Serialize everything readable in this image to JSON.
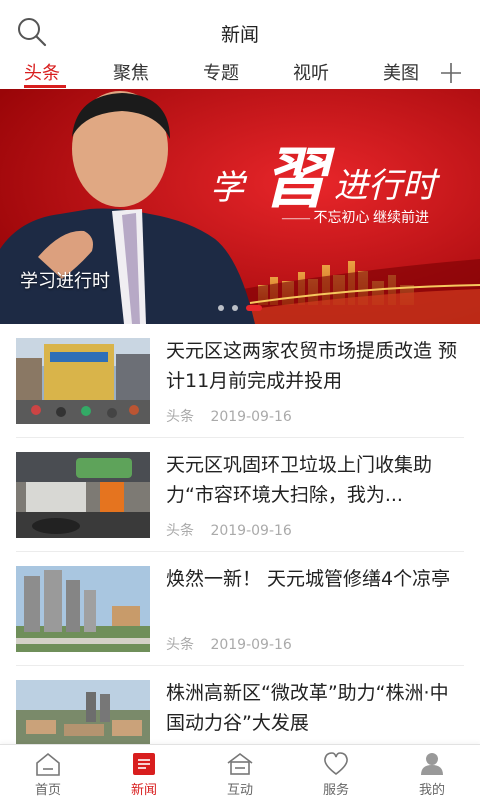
{
  "header": {
    "title": "新闻",
    "search_icon": "search-icon"
  },
  "tabs": [
    {
      "label": "头条",
      "active": true
    },
    {
      "label": "聚焦",
      "active": false
    },
    {
      "label": "专题",
      "active": false
    },
    {
      "label": "视听",
      "active": false
    },
    {
      "label": "美图",
      "active": false
    }
  ],
  "banner": {
    "caption": "学习进行时",
    "headline_xue": "学",
    "headline_xi": "習",
    "headline_rest": "进行时",
    "slogan": "—— 不忘初心  继续前进",
    "slide_count": 3,
    "active_slide": 3
  },
  "news": [
    {
      "headline": "天元区这两家农贸市场提质改造 预计11月前完成并投用",
      "category": "头条",
      "date": "2019-09-16"
    },
    {
      "headline": "天元区巩固环卫垃圾上门收集助力“市容环境大扫除，我为...",
      "category": "头条",
      "date": "2019-09-16"
    },
    {
      "headline": "焕然一新！ 天元城管修缮4个凉亭",
      "category": "头条",
      "date": "2019-09-16"
    },
    {
      "headline": "株洲高新区“微改革”助力“株洲·中国动力谷”大发展",
      "category": "",
      "date": ""
    }
  ],
  "bottom_nav": [
    {
      "label": "首页",
      "icon": "home-icon",
      "active": false
    },
    {
      "label": "新闻",
      "icon": "news-icon",
      "active": true
    },
    {
      "label": "互动",
      "icon": "interact-icon",
      "active": false
    },
    {
      "label": "服务",
      "icon": "heart-icon",
      "active": false
    },
    {
      "label": "我的",
      "icon": "profile-icon",
      "active": false
    }
  ],
  "colors": {
    "accent": "#d81e1e",
    "banner_red": "#b50d10"
  }
}
